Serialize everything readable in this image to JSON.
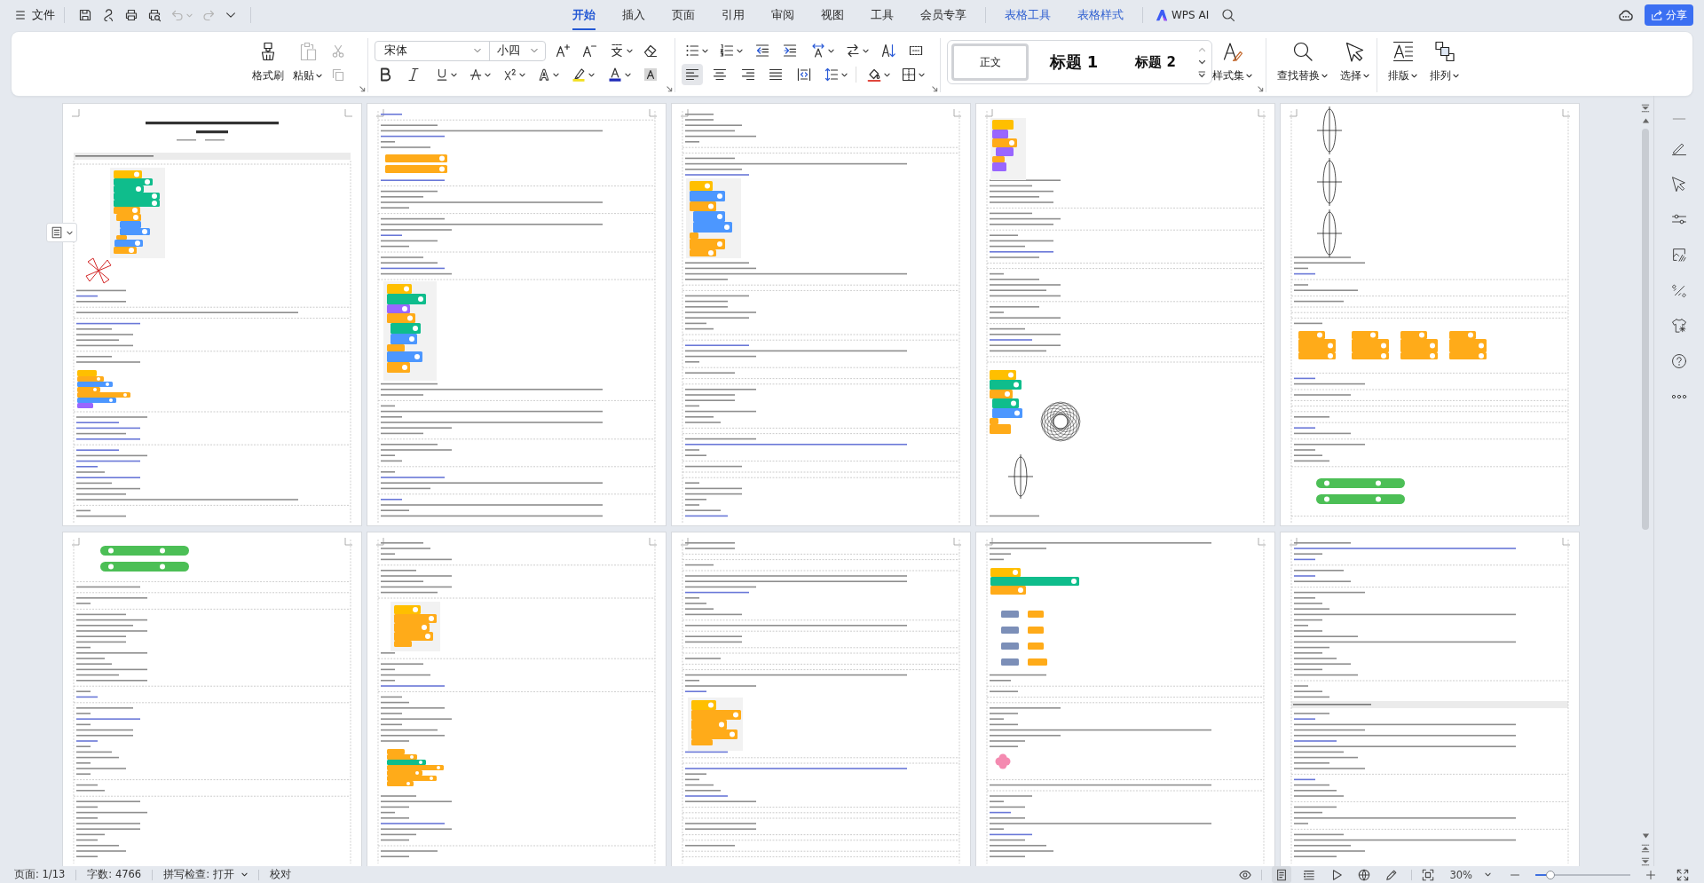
{
  "title_bar": {
    "menu_label": "文件",
    "undo": {
      "disabled": true
    },
    "redo": {
      "disabled": true
    },
    "tabs": [
      {
        "label": "开始",
        "kind": "main",
        "selected": true
      },
      {
        "label": "插入",
        "kind": "main",
        "selected": false
      },
      {
        "label": "页面",
        "kind": "main",
        "selected": false
      },
      {
        "label": "引用",
        "kind": "main",
        "selected": false
      },
      {
        "label": "审阅",
        "kind": "main",
        "selected": false
      },
      {
        "label": "视图",
        "kind": "main",
        "selected": false
      },
      {
        "label": "工具",
        "kind": "main",
        "selected": false
      },
      {
        "label": "会员专享",
        "kind": "main",
        "selected": false
      },
      {
        "label": "表格工具",
        "kind": "contextual",
        "selected": false
      },
      {
        "label": "表格样式",
        "kind": "contextual",
        "selected": false
      }
    ],
    "ai_label": "WPS AI",
    "share_label": "分享"
  },
  "ribbon": {
    "format_painter": "格式刷",
    "paste": {
      "label": "粘贴",
      "disabled": true
    },
    "cut": {
      "disabled": true
    },
    "copy": {
      "disabled": true
    },
    "font_name": "宋体",
    "font_size": "小四",
    "alignment": [
      {
        "selected": true
      },
      {
        "selected": false
      },
      {
        "selected": false
      },
      {
        "selected": false
      },
      {
        "selected": false
      }
    ],
    "styles": [
      {
        "label": "正文",
        "kind": "body",
        "selected": true
      },
      {
        "label": "标题 1",
        "kind": "heading1",
        "selected": false
      },
      {
        "label": "标题 2",
        "kind": "heading2",
        "selected": false
      }
    ],
    "style_set": "样式集",
    "find_replace": "查找替换",
    "select": "选择",
    "layout": "排版",
    "arrange": "排列"
  },
  "status_bar": {
    "page": "页面: 1/13",
    "word_count": "字数: 4766",
    "spell_check": "拼写检查: 打开",
    "proofread": "校对",
    "view_modes": [
      {
        "selected": true
      },
      {
        "selected": false
      },
      {
        "selected": false
      },
      {
        "selected": false
      },
      {
        "selected": false
      }
    ],
    "zoom": "30%",
    "zoom_slider": {
      "level": 0.16
    }
  }
}
